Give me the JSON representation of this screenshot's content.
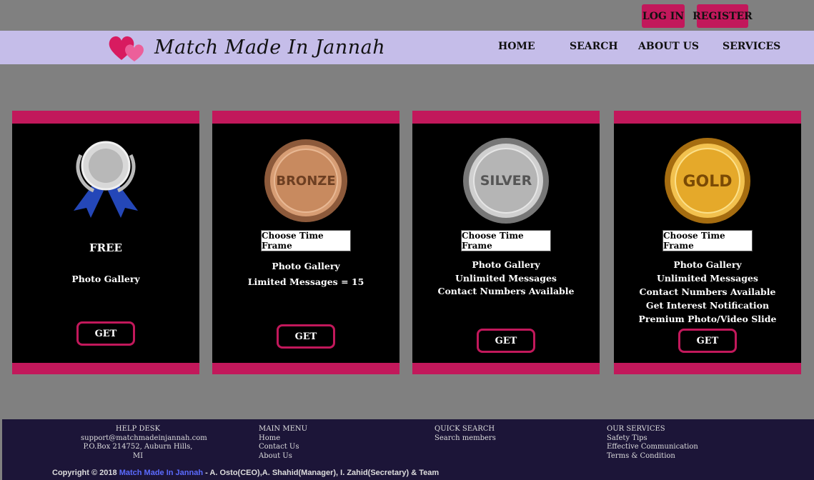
{
  "header": {
    "login": "LOG IN",
    "register": "REGISTER"
  },
  "nav": {
    "logo": "Match Made In Jannah",
    "items": [
      "HOME",
      "SEARCH",
      "ABOUT US",
      "SERVICES"
    ]
  },
  "plans": [
    {
      "name": "FREE",
      "features": [
        "Photo Gallery"
      ],
      "button": "GET"
    },
    {
      "medal": "BRONZE",
      "select": "Choose Time Frame",
      "features": [
        "Photo Gallery",
        "Limited Messages = 15"
      ],
      "button": "GET"
    },
    {
      "medal": "SILVER",
      "select": "Choose Time Frame",
      "features": [
        "Photo Gallery",
        "Unlimited Messages",
        "Contact Numbers Available"
      ],
      "button": "GET"
    },
    {
      "medal": "GOLD",
      "select": "Choose Time Frame",
      "features": [
        "Photo Gallery",
        "Unlimited Messages",
        "Contact Numbers Available",
        "Get Interest Notification",
        "Premium Photo/Video Slide"
      ],
      "button": "GET"
    }
  ],
  "footer": {
    "helpdesk": {
      "title": "HELP DESK",
      "email": "support@matchmadeinjannah.com",
      "address": "P.O.Box 214752, Auburn Hills, MI"
    },
    "main_menu": {
      "title": "MAIN MENU",
      "items": [
        "Home",
        "Contact Us",
        "About Us"
      ]
    },
    "quick_search": {
      "title": "QUICK SEARCH",
      "items": [
        "Search members"
      ]
    },
    "services": {
      "title": "OUR SERVICES",
      "items": [
        "Safety Tips",
        "Effective Communication",
        "Terms & Condition"
      ]
    },
    "copyright_prefix": "Copyright © 2018",
    "copyright_brand": "Match Made In Jannah",
    "copyright_suffix": "- A. Osto(CEO),A. Shahid(Manager), I. Zahid(Secretary) & Team"
  }
}
